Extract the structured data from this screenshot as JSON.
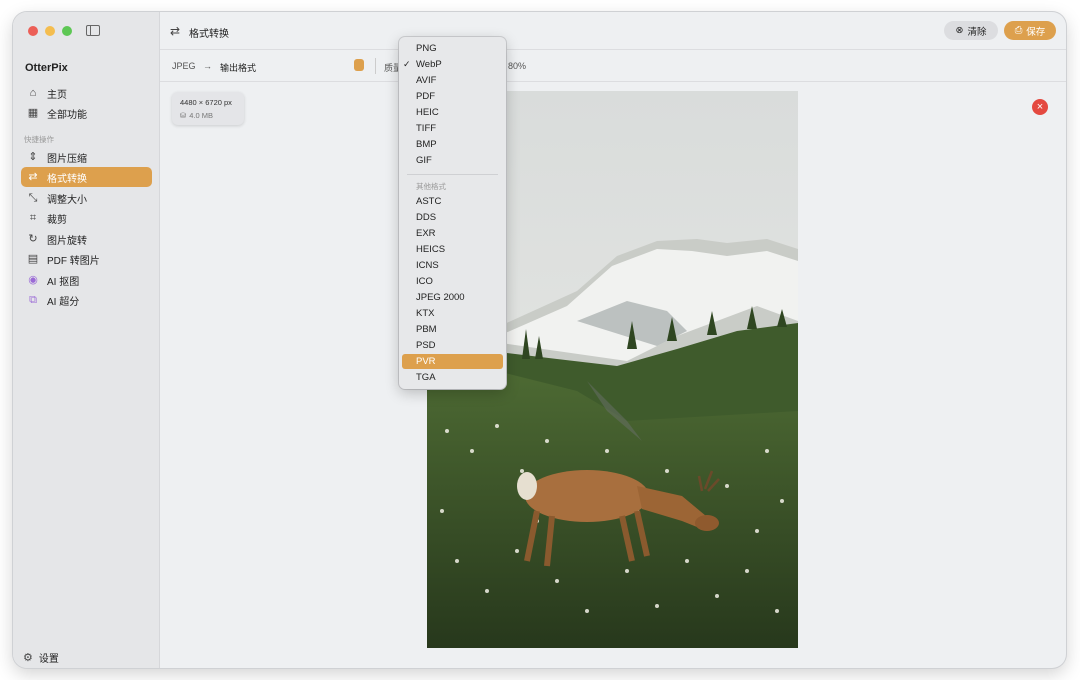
{
  "sidebar": {
    "app_name": "OtterPix",
    "main_items": [
      {
        "label": "主页",
        "icon": "home-icon"
      },
      {
        "label": "全部功能",
        "icon": "grid-icon"
      }
    ],
    "section_label": "快捷操作",
    "quick_items": [
      {
        "label": "图片压缩",
        "icon": "compress-icon"
      },
      {
        "label": "格式转换",
        "icon": "convert-icon",
        "active": true
      },
      {
        "label": "调整大小",
        "icon": "resize-icon"
      },
      {
        "label": "裁剪",
        "icon": "crop-icon"
      },
      {
        "label": "图片旋转",
        "icon": "rotate-icon"
      },
      {
        "label": "PDF 转图片",
        "icon": "pdf-icon"
      },
      {
        "label": "AI 抠图",
        "icon": "ai-cutout-icon"
      },
      {
        "label": "AI 超分",
        "icon": "ai-upscale-icon"
      }
    ],
    "settings_label": "设置"
  },
  "titlebar": {
    "title": "格式转换",
    "clear_label": "清除",
    "save_label": "保存"
  },
  "toolbar": {
    "source_format": "JPEG",
    "arrow": "→",
    "output_label": "输出格式",
    "quality_label": "质量",
    "quality_value": "80%",
    "quality_fraction": 0.8
  },
  "file_info": {
    "dimensions": "4480 × 6720 px",
    "file_size": "4.0 MB"
  },
  "format_menu": {
    "primary": [
      "PNG",
      "WebP",
      "AVIF",
      "PDF",
      "HEIC",
      "TIFF",
      "BMP",
      "GIF"
    ],
    "checked": "WebP",
    "other_label": "其他格式",
    "other": [
      "ASTC",
      "DDS",
      "EXR",
      "HEICS",
      "ICNS",
      "ICO",
      "JPEG 2000",
      "KTX",
      "PBM",
      "PSD",
      "PVR",
      "TGA"
    ],
    "highlighted": "PVR"
  },
  "colors": {
    "accent": "#dda04d",
    "close": "#e44940"
  }
}
